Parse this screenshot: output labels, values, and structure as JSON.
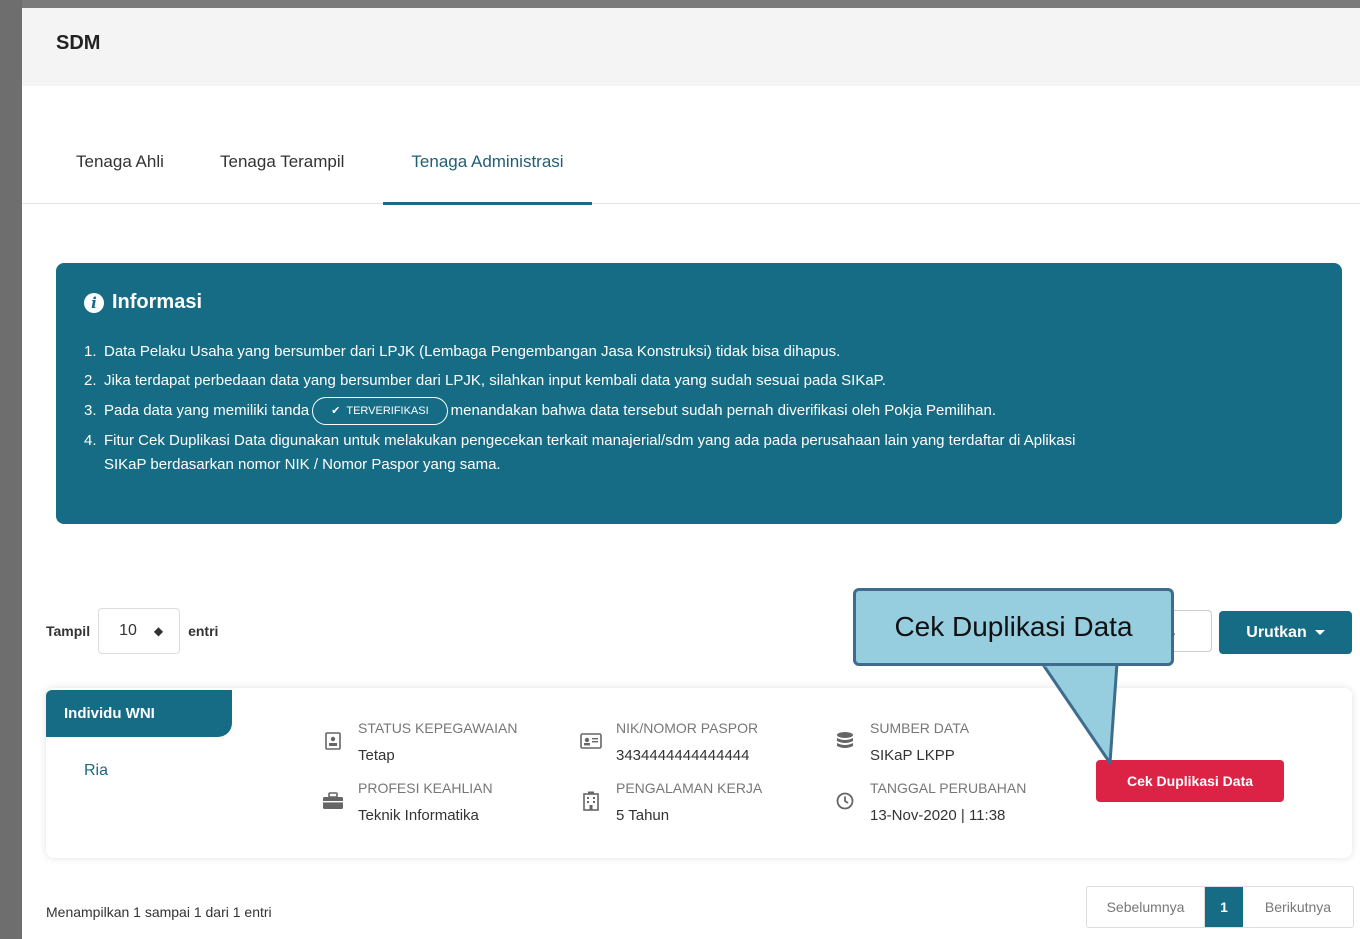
{
  "header": {
    "title": "SDM"
  },
  "tabs": [
    {
      "label": "Tenaga Ahli"
    },
    {
      "label": "Tenaga Terampil"
    },
    {
      "label": "Tenaga Administrasi"
    }
  ],
  "info": {
    "title": "Informasi",
    "items": [
      {
        "num": "1.",
        "text": "Data Pelaku Usaha yang bersumber dari LPJK (Lembaga Pengembangan Jasa Konstruksi) tidak bisa dihapus."
      },
      {
        "num": "2.",
        "text": "Jika terdapat perbedaan data yang bersumber dari LPJK, silahkan input kembali data yang sudah sesuai pada SIKaP."
      },
      {
        "num": "3.",
        "before": "Pada data yang memiliki tanda",
        "badge": "TERVERIFIKASI",
        "after": "menandakan bahwa data tersebut sudah pernah diverifikasi oleh Pokja Pemilihan."
      },
      {
        "num": "4.",
        "text": "Fitur Cek Duplikasi Data digunakan untuk melakukan pengecekan terkait manajerial/sdm yang ada pada perusahaan lain yang terdaftar di Aplikasi",
        "cont": "SIKaP berdasarkan nomor NIK / Nomor Paspor yang sama."
      }
    ]
  },
  "length_menu": {
    "prefix": "Tampil",
    "value": "10",
    "suffix": "entri"
  },
  "sort_button": {
    "label": "Urutkan"
  },
  "callout": {
    "text": "Cek Duplikasi Data"
  },
  "card": {
    "tag": "Individu WNI",
    "name": "Ria",
    "fields": [
      {
        "label": "STATUS KEPEGAWAIAN",
        "value": "Tetap",
        "icon": "id-card-icon"
      },
      {
        "label": "PROFESI KEAHLIAN",
        "value": "Teknik Informatika",
        "icon": "briefcase-icon"
      },
      {
        "label": "NIK/NOMOR PASPOR",
        "value": "3434444444444444",
        "icon": "id-badge-icon"
      },
      {
        "label": "PENGALAMAN KERJA",
        "value": "5 Tahun",
        "icon": "building-icon"
      },
      {
        "label": "SUMBER DATA",
        "value": "SIKaP LKPP",
        "icon": "database-icon"
      },
      {
        "label": "TANGGAL PERUBAHAN",
        "value": "13-Nov-2020 | 11:38",
        "icon": "clock-icon"
      }
    ],
    "button": "Cek Duplikasi Data"
  },
  "footer": {
    "info": "Menampilkan 1 sampai 1 dari 1 entri",
    "prev": "Sebelumnya",
    "current": "1",
    "next": "Berikutnya"
  },
  "colors": {
    "primary": "#166c84",
    "danger": "#dc2346",
    "callout": "#96cddf"
  }
}
